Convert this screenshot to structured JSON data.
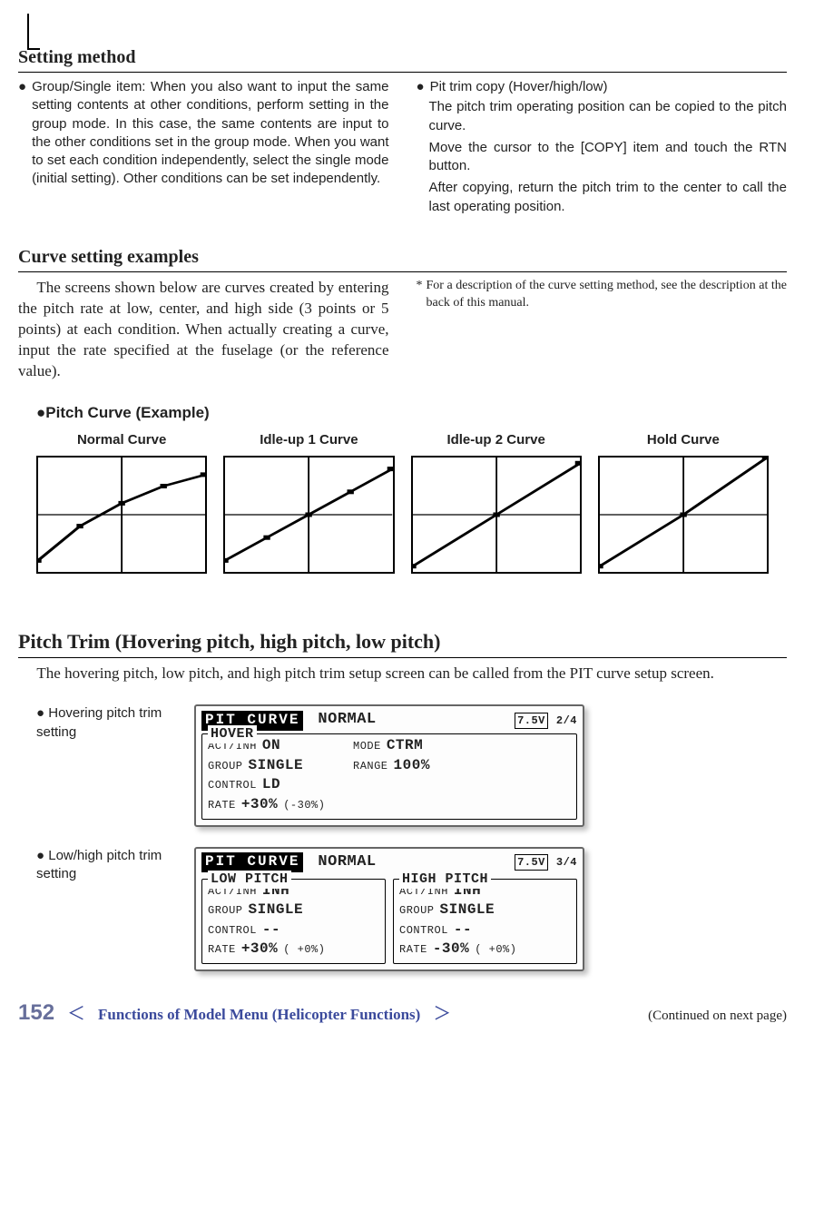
{
  "setting_method": {
    "heading": "Setting method",
    "left_bullet_lead": "●",
    "left_bullet": "Group/Single item: When you also want to input the same setting contents at other conditions, perform setting in the group mode. In this case, the same contents are input to the other conditions set in the group mode. When you want to set each condition independently, select the single mode (initial setting). Other conditions can be set independently.",
    "right_bullet_lead": "●",
    "right_bullet": "Pit trim copy (Hover/high/low)",
    "right_p1": "The pitch trim operating position can be copied to the pitch curve.",
    "right_p2": "Move the cursor to the [COPY] item and touch the RTN button.",
    "right_p3": "After copying, return the pitch trim to the center to call the last operating position."
  },
  "curve_examples": {
    "heading": "Curve setting examples",
    "intro": "The screens shown below are curves created by entering the pitch rate at low, center, and high side (3 points or 5 points) at each condition. When actually creating a curve, input the rate specified at the fuselage (or the reference value).",
    "note_star": "*",
    "note": "For a description of the curve setting method, see the description at the back of this manual.",
    "example_title": "●Pitch Curve (Example)",
    "curves": [
      {
        "label": "Normal Curve"
      },
      {
        "label": "Idle-up 1 Curve"
      },
      {
        "label": "Idle-up 2 Curve"
      },
      {
        "label": "Hold Curve"
      }
    ]
  },
  "pitch_trim": {
    "heading": "Pitch Trim (Hovering pitch, high pitch, low pitch)",
    "desc": "The hovering pitch, low pitch, and high pitch trim setup screen can be called from the PIT curve setup screen.",
    "row1_label_lead": "●",
    "row1_label": "Hovering pitch trim setting",
    "row2_label_lead": "●",
    "row2_label": "Low/high pitch trim setting"
  },
  "lcd1": {
    "title": "PIT CURVE",
    "condition": "NORMAL",
    "battery": "7.5V",
    "page": "2/4",
    "legend": "HOVER",
    "act_label": "ACT/INH",
    "act": "ON",
    "mode_label": "MODE",
    "mode": "CTRM",
    "group_label": "GROUP",
    "group": "SINGLE",
    "range_label": "RANGE",
    "range": "100%",
    "control_label": "CONTROL",
    "control": "LD",
    "rate_label": "RATE",
    "rate": "+30%",
    "rate_paren": "(-30%)"
  },
  "lcd2": {
    "title": "PIT CURVE",
    "condition": "NORMAL",
    "battery": "7.5V",
    "page": "3/4",
    "low": {
      "legend": "LOW PITCH",
      "act_label": "ACT/INH",
      "act": "INH",
      "group_label": "GROUP",
      "group": "SINGLE",
      "control_label": "CONTROL",
      "control": "--",
      "rate_label": "RATE",
      "rate": "+30%",
      "rate_paren": "( +0%)"
    },
    "high": {
      "legend": "HIGH PITCH",
      "act_label": "ACT/INH",
      "act": "INH",
      "group_label": "GROUP",
      "group": "SINGLE",
      "control_label": "CONTROL",
      "control": "--",
      "rate_label": "RATE",
      "rate": "-30%",
      "rate_paren": "( +0%)"
    }
  },
  "footer": {
    "page_number": "152",
    "angle_l": "＜",
    "title": "Functions of Model Menu (Helicopter Functions)",
    "angle_r": "＞",
    "continued": "(Continued on next page)"
  },
  "chart_data": [
    {
      "type": "line",
      "title": "Normal Curve",
      "x": [
        0,
        25,
        50,
        75,
        100
      ],
      "y": [
        10,
        40,
        60,
        75,
        85
      ],
      "xlim": [
        0,
        100
      ],
      "ylim": [
        0,
        100
      ]
    },
    {
      "type": "line",
      "title": "Idle-up 1 Curve",
      "x": [
        0,
        25,
        50,
        75,
        100
      ],
      "y": [
        10,
        30,
        50,
        70,
        90
      ],
      "xlim": [
        0,
        100
      ],
      "ylim": [
        0,
        100
      ]
    },
    {
      "type": "line",
      "title": "Idle-up 2 Curve",
      "x": [
        0,
        50,
        100
      ],
      "y": [
        5,
        50,
        95
      ],
      "xlim": [
        0,
        100
      ],
      "ylim": [
        0,
        100
      ]
    },
    {
      "type": "line",
      "title": "Hold Curve",
      "x": [
        0,
        50,
        100
      ],
      "y": [
        5,
        50,
        100
      ],
      "xlim": [
        0,
        100
      ],
      "ylim": [
        0,
        100
      ]
    }
  ]
}
